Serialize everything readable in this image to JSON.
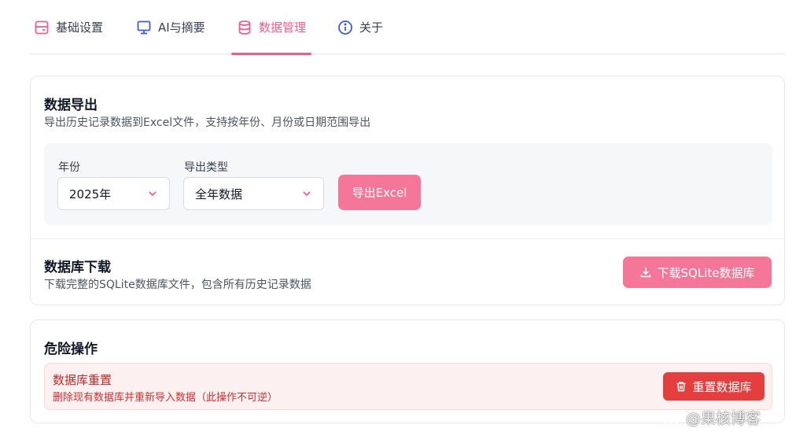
{
  "tabs": [
    {
      "label": "基础设置",
      "icon": "panel-icon",
      "active": false
    },
    {
      "label": "AI与摘要",
      "icon": "monitor-icon",
      "active": false
    },
    {
      "label": "数据管理",
      "icon": "database-icon",
      "active": true
    },
    {
      "label": "关于",
      "icon": "info-icon",
      "active": false
    }
  ],
  "export": {
    "title": "数据导出",
    "description": "导出历史记录数据到Excel文件，支持按年份、月份或日期范围导出",
    "year_label": "年份",
    "year_value": "2025年",
    "type_label": "导出类型",
    "type_value": "全年数据",
    "button_label": "导出Excel"
  },
  "database": {
    "title": "数据库下载",
    "description": "下载完整的SQLite数据库文件，包含所有历史记录数据",
    "button_label": "下载SQLite数据库",
    "button_icon": "download-icon"
  },
  "danger": {
    "title": "危险操作",
    "reset_title": "数据库重置",
    "reset_description": "删除现有数据库并重新导入数据（此操作不可逆）",
    "button_label": "重置数据库",
    "button_icon": "trash-icon"
  },
  "watermark": {
    "text": "@果核博客"
  },
  "colors": {
    "accent": "#ec5f8c",
    "button_pink": "#f47699",
    "danger": "#e53e3e",
    "danger_bg": "#fdf0f0"
  }
}
